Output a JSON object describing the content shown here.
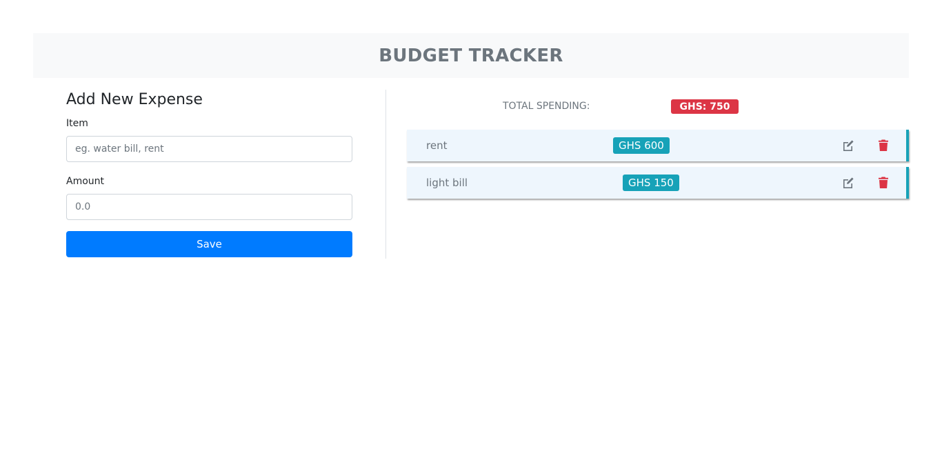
{
  "header": {
    "title": "BUDGET TRACKER"
  },
  "form": {
    "title": "Add New Expense",
    "item_label": "Item",
    "item_placeholder": "eg. water bill, rent",
    "amount_label": "Amount",
    "amount_placeholder": "0.0",
    "save_label": "Save"
  },
  "summary": {
    "total_label": "TOTAL SPENDING:",
    "total_value": "GHS: 750"
  },
  "expenses": [
    {
      "name": "rent",
      "amount": "GHS 600",
      "edit_icon": "edit-icon",
      "delete_icon": "trash-icon"
    },
    {
      "name": "light bill",
      "amount": "GHS 150",
      "edit_icon": "edit-icon",
      "delete_icon": "trash-icon"
    }
  ],
  "colors": {
    "primary": "#007bff",
    "danger": "#dc3545",
    "info": "#17a2b8",
    "muted": "#6c757d",
    "header_bg": "#f8f9fa",
    "row_bg": "#eef6fd"
  }
}
